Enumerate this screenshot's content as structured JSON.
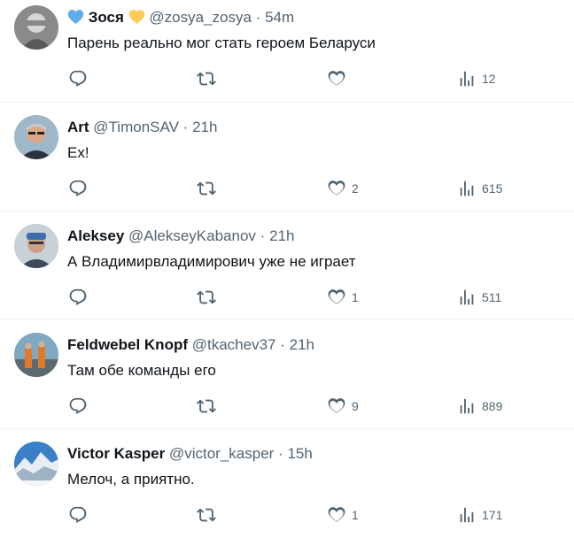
{
  "tweets": [
    {
      "name": "Зося",
      "emoji_before": "blue-heart",
      "emoji_after": "yellow-heart",
      "handle": "@zosya_zosya",
      "time": "54m",
      "text": "Парень реально мог стать героем Беларуси",
      "likes": "",
      "views": "12"
    },
    {
      "name": "Art",
      "handle": "@TimonSAV",
      "time": "21h",
      "text": "Ех!",
      "likes": "2",
      "views": "615"
    },
    {
      "name": "Aleksey",
      "handle": "@AlekseyKabanov",
      "time": "21h",
      "text": "А Владимирвладимирович уже не играет",
      "likes": "1",
      "views": "511"
    },
    {
      "name": "Feldwebel Knopf",
      "handle": "@tkachev37",
      "time": "21h",
      "text": "Там обе команды его",
      "likes": "9",
      "views": "889"
    },
    {
      "name": "Victor Kasper",
      "handle": "@victor_kasper",
      "time": "15h",
      "text": "Мелоч, а приятно.",
      "likes": "1",
      "views": "171"
    }
  ],
  "dot": "·",
  "colors": {
    "secondary_text": "#536471",
    "primary_text": "#0f1419",
    "divider": "#eff3f4"
  },
  "icons": [
    "reply-icon",
    "retweet-icon",
    "like-icon",
    "views-icon"
  ]
}
